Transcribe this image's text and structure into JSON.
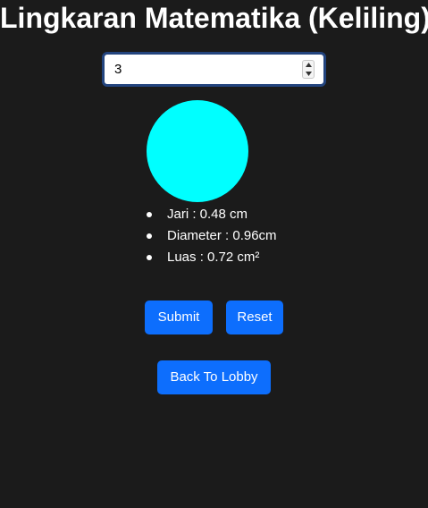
{
  "page": {
    "title": "Lingkaran Matematika (Keliling)"
  },
  "form": {
    "input_value": "3"
  },
  "circle": {
    "color": "#00ffff"
  },
  "results": [
    {
      "text": "Jari : 0.48 cm"
    },
    {
      "text": "Diameter : 0.96cm"
    },
    {
      "text": "Luas : 0.72 cm²"
    }
  ],
  "buttons": {
    "submit_label": "Submit",
    "reset_label": "Reset",
    "lobby_label": "Back To Lobby"
  },
  "colors": {
    "background": "#1b1b1b",
    "button": "#0d6efd",
    "input_focus_border": "#23447e"
  },
  "icons": {
    "spinner_up": "chevron-up-icon",
    "spinner_down": "chevron-down-icon"
  }
}
